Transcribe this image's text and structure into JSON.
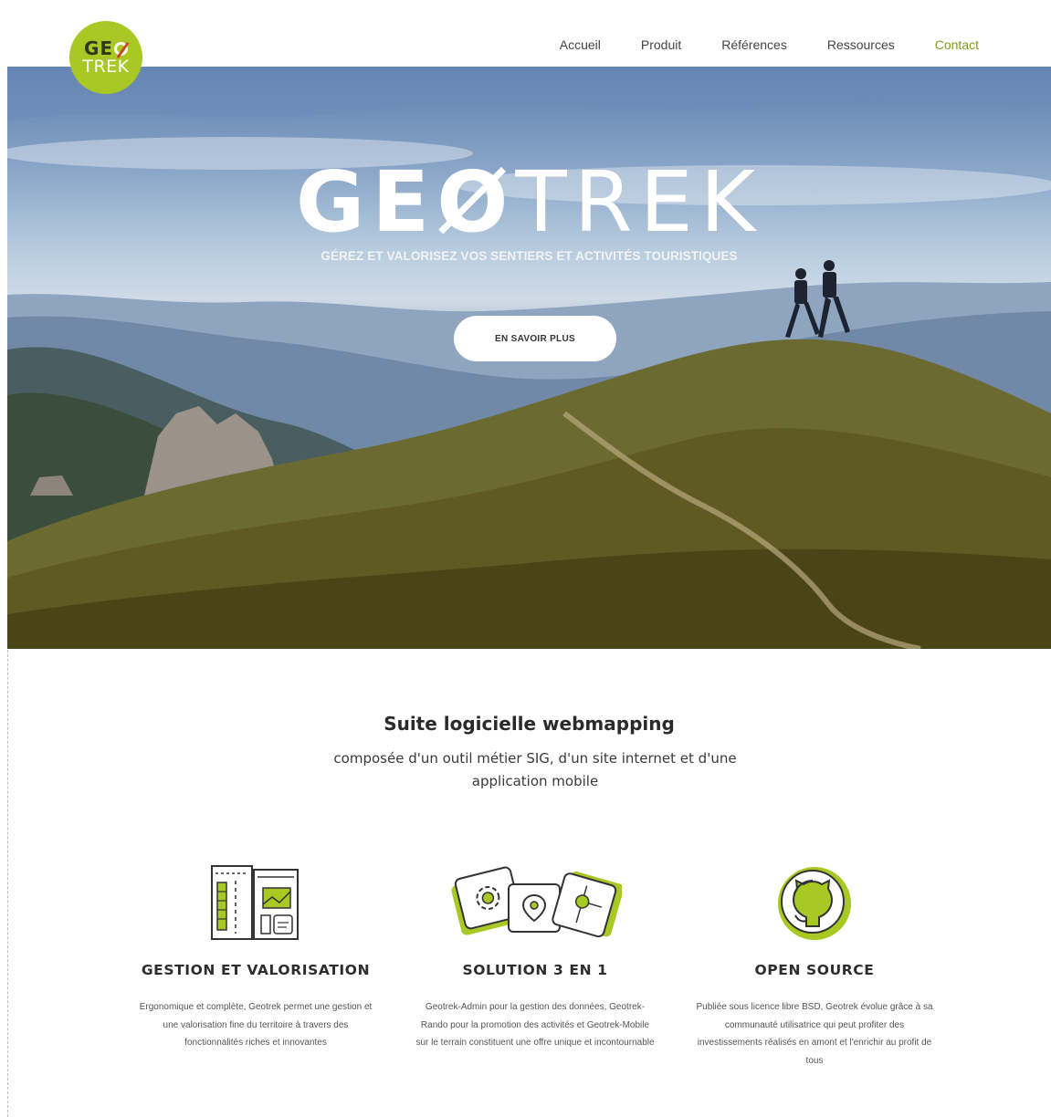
{
  "header": {
    "logo": {
      "line1": "GEO",
      "line2": "TREK"
    },
    "nav": [
      "Accueil",
      "Produit",
      "Références",
      "Ressources",
      "Contact"
    ]
  },
  "hero": {
    "title_bold": "GEØ",
    "title_thin": "TREK",
    "tagline": "GÉREZ ET VALORISEZ VOS SENTIERS ET ACTIVITÉS TOURISTIQUES",
    "cta": "EN SAVOIR PLUS"
  },
  "intro": {
    "title": "Suite logicielle webmapping",
    "subtitle": "composée d'un outil métier SIG, d'un site internet et d'une application mobile"
  },
  "features": [
    {
      "icon": "dashboard-icon",
      "title": "GESTION ET VALORISATION",
      "text": "Ergonomique et complète, Geotrek permet une gestion et une valorisation fine du territoire à travers des fonctionnalités riches et innovantes"
    },
    {
      "icon": "apps-icon",
      "title": "SOLUTION 3 EN 1",
      "text": "Geotrek-Admin pour la gestion des données, Geotrek-Rando pour la promotion des activités et Geotrek-Mobile sur le terrain constituent une offre unique et incontournable"
    },
    {
      "icon": "github-icon",
      "title": "OPEN SOURCE",
      "text": "Publiée sous licence libre BSD, Geotrek évolue grâce à sa communauté utilisatrice qui peut profiter des investissements réalisés en amont et l'enrichir au profit de tous"
    }
  ],
  "colors": {
    "accent": "#a9c823",
    "nav_active": "#7f9a1a"
  }
}
